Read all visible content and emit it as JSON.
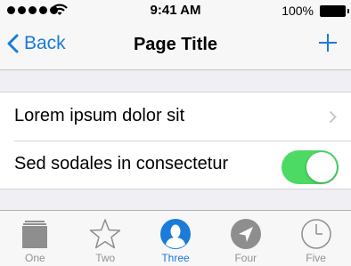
{
  "status_bar": {
    "time": "9:41 AM",
    "battery_percent": "100%",
    "signal_bars": 5
  },
  "nav": {
    "back_label": "Back",
    "title": "Page Title"
  },
  "list": {
    "rows": [
      {
        "label": "Lorem ipsum dolor sit",
        "accessory": "chevron"
      },
      {
        "label": "Sed sodales in consectetur",
        "accessory": "toggle",
        "toggle_on": true
      }
    ]
  },
  "tabs": [
    {
      "label": "One",
      "icon": "square-icon",
      "active": false
    },
    {
      "label": "Two",
      "icon": "star-icon",
      "active": false
    },
    {
      "label": "Three",
      "icon": "person-icon",
      "active": true
    },
    {
      "label": "Four",
      "icon": "location-arrow-icon",
      "active": false
    },
    {
      "label": "Five",
      "icon": "clock-icon",
      "active": false
    }
  ],
  "colors": {
    "accent": "#1b7bd9",
    "toggle_on": "#4cd964",
    "inactive_tab": "#929292"
  }
}
